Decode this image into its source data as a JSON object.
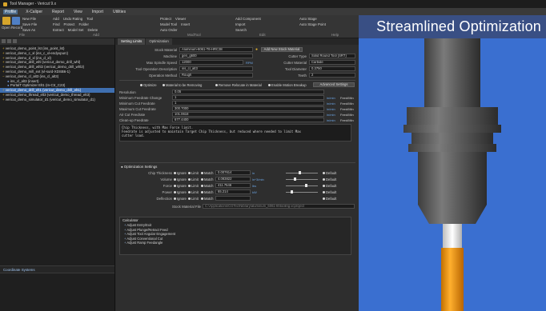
{
  "window": {
    "title": "Tool Manager - Vericut 9.x"
  },
  "menu": [
    "Profile",
    "X-Caliper",
    "Report",
    "View",
    "Import",
    "Utilities"
  ],
  "ribbon": {
    "file": {
      "open": "Open",
      "record": "Record",
      "rows": [
        "New File",
        "Save File",
        "Save As"
      ],
      "label": "File"
    },
    "add": {
      "rows": [
        "Add",
        "Undo Rating",
        "Tool",
        "Find",
        "Protect",
        "Folder",
        "Extract",
        "Model Set",
        "Delete"
      ],
      "label": "Add"
    },
    "modtool": {
      "rows": [
        "Protect",
        "Viewer",
        "Model Tool",
        "Insert",
        "Auto Order"
      ],
      "label": "ModTool"
    },
    "edit": {
      "rows": [
        "Add Component",
        "Import",
        "Search"
      ],
      "label": "Edit"
    },
    "help": {
      "rows": [
        "Auto Stage",
        "Auto Stage Point",
        "Help"
      ],
      "label": "Help"
    }
  },
  "banner": "Streamlined Optimization",
  "tree": [
    {
      "text": "vericut_demo_point_lst (ins_point_lst)"
    },
    {
      "text": "vericut_demo_c_xl (ins_c_xl-endyxpurc)"
    },
    {
      "text": "vericut_demo_d_xl (ins_d_xl)"
    },
    {
      "text": "vericut_demo_drill_whl (vericut_demo_drill_whl)"
    },
    {
      "text": "vericut_demo_drill_whl2 (vericut_demo_drill_whl2)"
    },
    {
      "text": "vericut_demo_mill_ext (vl-surd-XDSB6-1)"
    },
    {
      "text": "vericut_demo_cl_alt3 (ins_cl_alt3)"
    },
    {
      "text": "ins_cl_alt3 (insert)"
    },
    {
      "text": "PortalT Optimizer Elt1 (In-Ctr_C23)"
    },
    {
      "text": "vericut_demo_drill_elt1 (vericut_demo_drill_elt1)",
      "selected": true
    },
    {
      "text": "vericut_demo_thread_elt3 (vericut_demo_thread_elt3)"
    },
    {
      "text": "vericut_demo_simulator_d1 (vericut_demo_simulator_d1)"
    }
  ],
  "coord_section": "Coordinate Systems",
  "tabs": [
    "Setting Limits",
    "Optimization"
  ],
  "form": {
    "stock_material_label": "Stock Material",
    "stock_material": "Aluminum-6061-T6-HRC38",
    "add_stock_button": "Add New Stock Material",
    "machine_label": "Machine",
    "machine": "gen_g600",
    "cutter_type_label": "Cutter Type",
    "cutter_type": "Solid Round Tool (SRT)",
    "max_spindle_label": "Max Spindle Speed",
    "max_spindle": "12000",
    "max_spindle_unit": "RPM",
    "cutter_material_label": "Cutter Material",
    "cutter_material": "Carbide",
    "tool_desc_label": "Tool Operation Description",
    "tool_desc": "ins_cl_alt3",
    "tool_diameter_label": "Tool Diameter",
    "tool_diameter": "0.3750",
    "op_method_label": "Operation Method",
    "op_method": "Rough",
    "teeth_label": "Teeth",
    "teeth": "2",
    "opt_radios": [
      "Optimize",
      "Material to be Removing",
      "Remove Relocate in Material",
      "Enable Motion Breakup"
    ],
    "adv_button": "Advanced Settings",
    "resolution_label": "Resolution",
    "resolution": "0.05",
    "feed_rows": [
      {
        "label": "Minimum Feedrate Change",
        "value": "1",
        "unit": "in/min"
      },
      {
        "label": "Minimum Cut Feedrate",
        "value": "1",
        "unit": "in/min"
      },
      {
        "label": "Maximum Cut Feedrate",
        "value": "300.7000",
        "unit": "in/min"
      },
      {
        "label": "Air Cut Feedrate",
        "value": "101.0618",
        "unit": "in/min"
      },
      {
        "label": "Clean-up Feedrate",
        "value": "677.4400",
        "unit": "in/min"
      }
    ],
    "feed_unit_label": "Feed/Min",
    "note": "Chip Thickness, with Max Force limit.\nFeedrate is adjusted to maintain Target Chip Thickness, but reduced where needed to limit Max\ncutter load.",
    "opt_settings_label": "Optimization Settings",
    "opt_rows": [
      {
        "label": "Chip Thickness",
        "opts": [
          "Ignore",
          "Limit",
          "Match"
        ],
        "value": "0.007614",
        "unit": "in",
        "default": "Default"
      },
      {
        "label": "Volume",
        "opts": [
          "Ignore",
          "Limit",
          "Match"
        ],
        "value": "4.083822",
        "unit": "in^3/min",
        "default": "Default"
      },
      {
        "label": "Force",
        "opts": [
          "Ignore",
          "Limit",
          "Match"
        ],
        "value": "411.7546",
        "unit": "lbs",
        "default": "Default"
      },
      {
        "label": "Power",
        "opts": [
          "Ignore",
          "Limit",
          "Match"
        ],
        "value": "65.214",
        "unit": "kW",
        "default": "Default"
      },
      {
        "label": "Deflection",
        "opts": [
          "Ignore",
          "Limit",
          "Match"
        ],
        "value": "",
        "unit": "",
        "default": "Default"
      }
    ],
    "stock_file_label": "Stock Material File",
    "stock_file": "C:\\Applications\\CGTech\\library\\aluminum_6061-t6\\tooling.vcproject",
    "calc_title": "Calculator",
    "calc_items": [
      "Adjust Entry/Exit",
      "Adjust Plunge/Retract Feed",
      "Adjust Tool Angular Engagement",
      "Adjust Conventional Cut",
      "Adjust Ramp Feedangle"
    ]
  },
  "colors": {
    "viewport_bg": "#3a6fd0",
    "banner_bg": "#394f84",
    "selection": "#3f6fb0",
    "tool_tip": "#f0a01a"
  }
}
